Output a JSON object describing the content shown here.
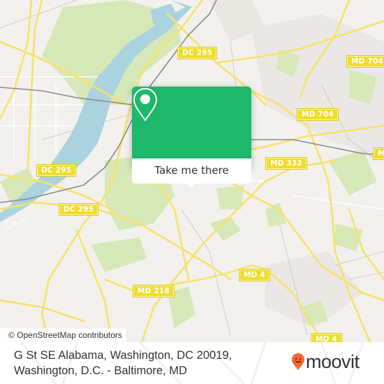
{
  "map": {
    "attribution": "© OpenStreetMap contributors",
    "river_label": "tia River",
    "road_shields": [
      {
        "id": "dc295-top",
        "label": "DC 295"
      },
      {
        "id": "dc295-mid",
        "label": "DC 295"
      },
      {
        "id": "dc295-low",
        "label": "DC 295"
      },
      {
        "id": "md704-top",
        "label": "MD 704"
      },
      {
        "id": "md704-mid",
        "label": "MD 704"
      },
      {
        "id": "md332",
        "label": "MD 332"
      },
      {
        "id": "md-right",
        "label": "MD"
      },
      {
        "id": "md218",
        "label": "MD 218"
      },
      {
        "id": "md4",
        "label": "MD 4"
      },
      {
        "id": "md4-bottom",
        "label": "MD 4"
      }
    ],
    "colors": {
      "land": "#f2f1ed",
      "park": "#d6e8b8",
      "water": "#aad3df",
      "road": "#f6e26b",
      "railway": "#8a8a8a"
    }
  },
  "popup": {
    "icon": "location-pin-icon",
    "button_label": "Take me there",
    "accent_color": "#1db86a"
  },
  "footer": {
    "address_line1": "G St SE Alabama, Washington, DC 20019,",
    "address_line2": "Washington, D.C. - Baltimore, MD",
    "logo_text": "moovit",
    "logo_color": "#f26a36"
  }
}
